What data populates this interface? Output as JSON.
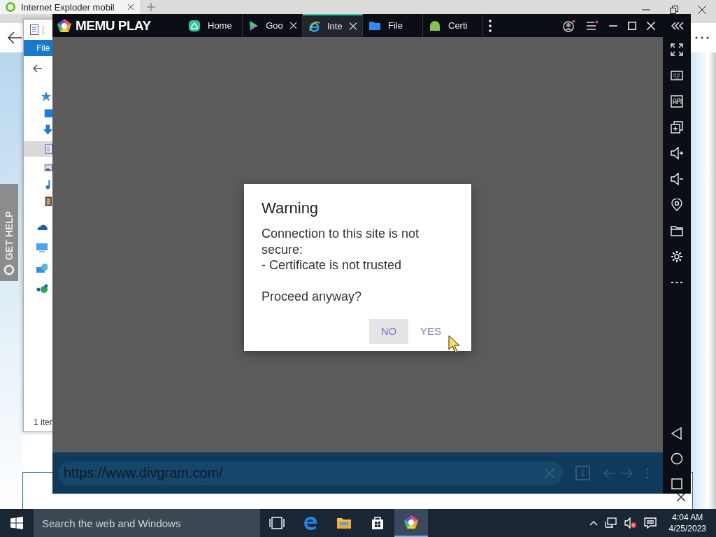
{
  "browser": {
    "tab_title": "Internet Exploder mobil"
  },
  "explorer": {
    "menu": "File",
    "status": "1 iter"
  },
  "help_tab": {
    "label": "GET HELP"
  },
  "memu": {
    "logo": "MEMU PLAY",
    "tabs": [
      {
        "label": "Home",
        "selected": false,
        "closable": false
      },
      {
        "label": "Goo",
        "selected": false,
        "closable": true
      },
      {
        "label": "Inte",
        "selected": true,
        "closable": true
      },
      {
        "label": "File",
        "selected": false,
        "closable": false
      },
      {
        "label": "Certi",
        "selected": false,
        "closable": false
      }
    ],
    "dialog": {
      "title": "Warning",
      "message": "Connection to this site is not secure:\n - Certificate is not trusted\n\nProceed anyway?",
      "buttons": [
        {
          "label": "NO",
          "focused": true
        },
        {
          "label": "YES",
          "focused": false
        }
      ]
    },
    "address_bar": {
      "url": "https://www.divgram.com/",
      "tab_count": "1"
    }
  },
  "taskbar": {
    "search_placeholder": "Search the web and Windows",
    "apps": [
      {
        "active": false
      },
      {
        "active": false
      },
      {
        "active": false
      },
      {
        "active": false
      },
      {
        "active": true
      }
    ],
    "time": "4:04 AM",
    "date": "4/25/2023"
  }
}
